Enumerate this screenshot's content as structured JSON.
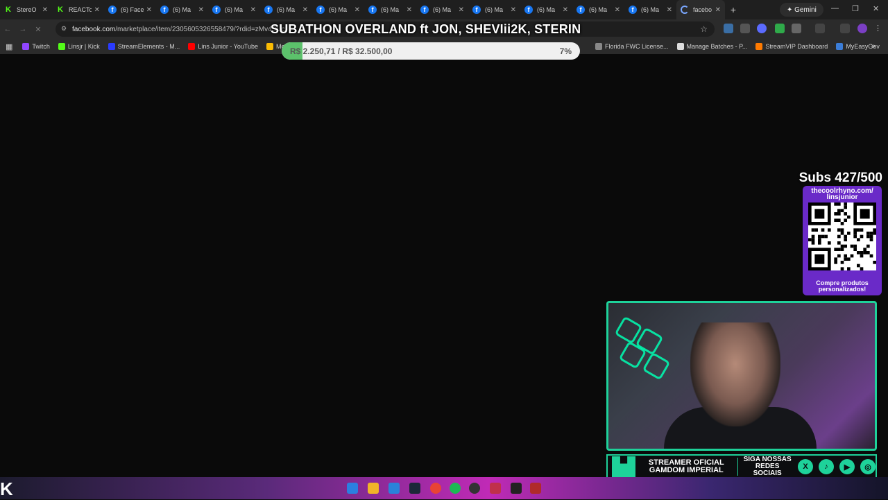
{
  "tabs": [
    {
      "label": "StereO",
      "icon": "kick"
    },
    {
      "label": "REACTo",
      "icon": "kick"
    },
    {
      "label": "(6) Face",
      "icon": "fb"
    },
    {
      "label": "(6) Ma",
      "icon": "fb"
    },
    {
      "label": "(6) Ma",
      "icon": "fb"
    },
    {
      "label": "(6) Ma",
      "icon": "fb"
    },
    {
      "label": "(6) Ma",
      "icon": "fb"
    },
    {
      "label": "(6) Ma",
      "icon": "fb"
    },
    {
      "label": "(6) Ma",
      "icon": "fb"
    },
    {
      "label": "(6) Ma",
      "icon": "fb"
    },
    {
      "label": "(6) Ma",
      "icon": "fb"
    },
    {
      "label": "(6) Ma",
      "icon": "fb"
    },
    {
      "label": "(6) Ma",
      "icon": "fb"
    },
    {
      "label": "facebo",
      "icon": "loading",
      "active": true
    }
  ],
  "gemini_label": "✦ Gemini",
  "url": {
    "site": "facebook.com",
    "path": "/marketplace/item/2305605326558479/?rdid=zMv4SUc"
  },
  "bookmarks": [
    {
      "label": "Twitch",
      "color": "#9146ff"
    },
    {
      "label": "Linsjr | Kick",
      "color": "#53fc18"
    },
    {
      "label": "StreamElements - M...",
      "color": "#2a3bff"
    },
    {
      "label": "Lins Junior - YouTube",
      "color": "#ff0000"
    },
    {
      "label": "Meu Drive",
      "color": "#fbbc04"
    },
    {
      "label": "Florida FWC License...",
      "color": "#888888"
    },
    {
      "label": "Manage Batches - P...",
      "color": "#dddddd"
    },
    {
      "label": "StreamVIP Dashboard",
      "color": "#ff7a00"
    },
    {
      "label": "MyEasyGov",
      "color": "#3b7dd8"
    }
  ],
  "overlay": {
    "title": "SUBATHON OVERLAND ft JON, SHEVIii2K, STERIN",
    "goal_text": "R$ 2.250,71 / R$ 32.500,00",
    "goal_percent_label": "7%",
    "goal_fraction": 0.07,
    "subs": "Subs 427/500",
    "qr_url": "thecoolrhyno.com/ linsjunior",
    "qr_caption": "Compre produtos personalizados!",
    "banner_left": "STREAMER OFICIAL GAMDOM IMPERIAL",
    "banner_right": "SIGA NOSSAS REDES SOCIAIS",
    "socials": [
      "X",
      "♪",
      "▶",
      "◎"
    ]
  },
  "colors": {
    "accent": "#1ed29a",
    "goal_fill": "#5cc16b",
    "qr_card": "#6a2ac8"
  }
}
